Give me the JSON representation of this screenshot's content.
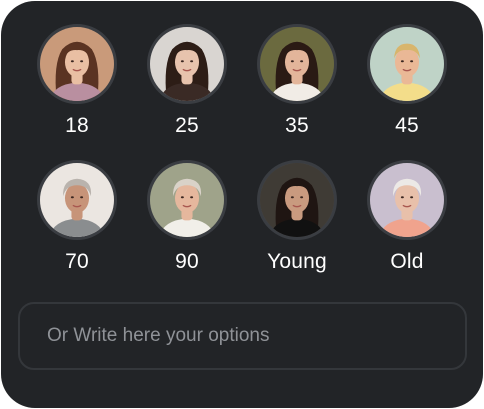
{
  "options": [
    {
      "label": "18",
      "portrait": "girl-long-brown-hair",
      "bg": "#c99a7a",
      "hair": "#5a3322",
      "skin": "#e9bfa3",
      "shirt": "#b98fa0"
    },
    {
      "label": "25",
      "portrait": "woman-dark-hair",
      "bg": "#d9d5d1",
      "hair": "#2d1d16",
      "skin": "#e7c3ad",
      "shirt": "#3a2a25"
    },
    {
      "label": "35",
      "portrait": "woman-dark-hair-outdoor",
      "bg": "#6b6a3f",
      "hair": "#2a1a14",
      "skin": "#e3b59a",
      "shirt": "#f1ece6"
    },
    {
      "label": "45",
      "portrait": "woman-blonde-smiling",
      "bg": "#bfd3c7",
      "hair": "#d8b56c",
      "skin": "#eab896",
      "shirt": "#f3dd8a"
    },
    {
      "label": "70",
      "portrait": "elderly-woman-gray-short-hair",
      "bg": "#ebe6e1",
      "hair": "#b9b3ad",
      "skin": "#c79479",
      "shirt": "#8a8d8f"
    },
    {
      "label": "90",
      "portrait": "elderly-woman-smiling",
      "bg": "#9fa38a",
      "hair": "#d9d2c8",
      "skin": "#e5b79d",
      "shirt": "#f1efe9"
    },
    {
      "label": "Young",
      "portrait": "young-woman-dark-hair",
      "bg": "#3f3b35",
      "hair": "#1f1512",
      "skin": "#c99a7f",
      "shirt": "#111111"
    },
    {
      "label": "Old",
      "portrait": "elderly-woman-white-hair",
      "bg": "#c9bfcf",
      "hair": "#ece9e6",
      "skin": "#e8c0aa",
      "shirt": "#f0a38d"
    }
  ],
  "input": {
    "placeholder": "Or Write here your options",
    "value": ""
  },
  "colors": {
    "panel_bg": "#222427",
    "avatar_ring": "#3a3d42",
    "label": "#ffffff",
    "input_border": "#34373b",
    "placeholder": "#8f9297"
  }
}
